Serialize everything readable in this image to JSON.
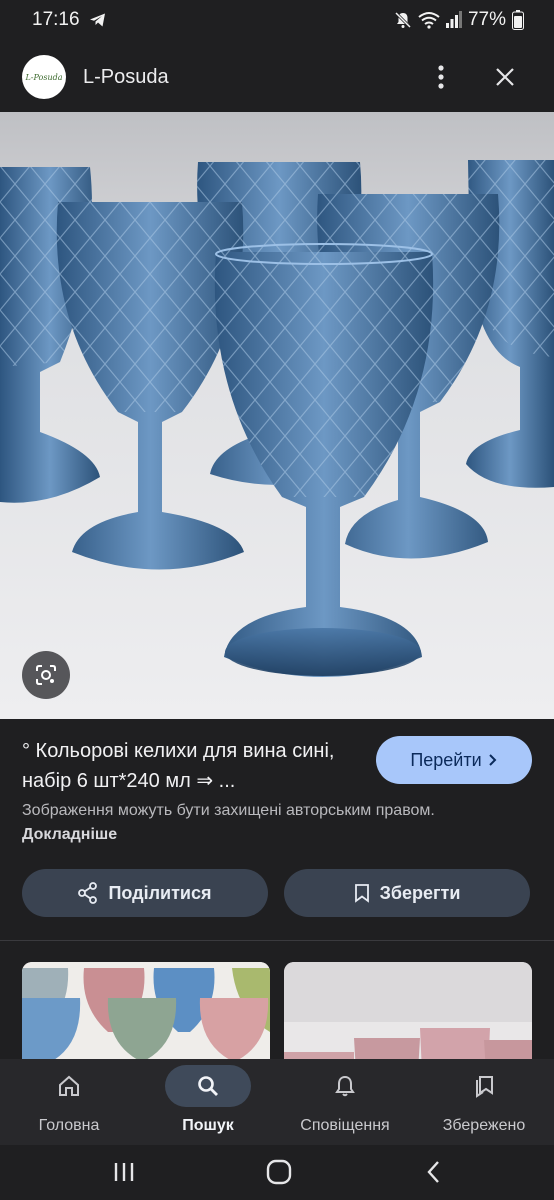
{
  "status_bar": {
    "time": "17:16",
    "battery": "77%"
  },
  "header": {
    "logo_text": "L-Posuda",
    "site_name": "L-Posuda"
  },
  "result": {
    "title": "° Кольорові келихи для вина сині, набір 6 шт*240 мл ⇒ ...",
    "visit_label": "Перейти",
    "copyright_text": "Зображення можуть бути захищені авторським правом.",
    "learn_more": "Докладніше"
  },
  "actions": {
    "share_label": "Поділитися",
    "save_label": "Зберегти"
  },
  "bottom_nav": {
    "items": [
      {
        "label": "Головна",
        "icon": "home-icon"
      },
      {
        "label": "Пошук",
        "icon": "search-icon",
        "active": true
      },
      {
        "label": "Сповіщення",
        "icon": "bell-icon"
      },
      {
        "label": "Збережено",
        "icon": "saved-icon"
      }
    ]
  },
  "colors": {
    "background": "#1f1f21",
    "visit_button": "#a8c7fa",
    "action_button": "#3a4351",
    "glass_blue": "#3f6a96"
  }
}
